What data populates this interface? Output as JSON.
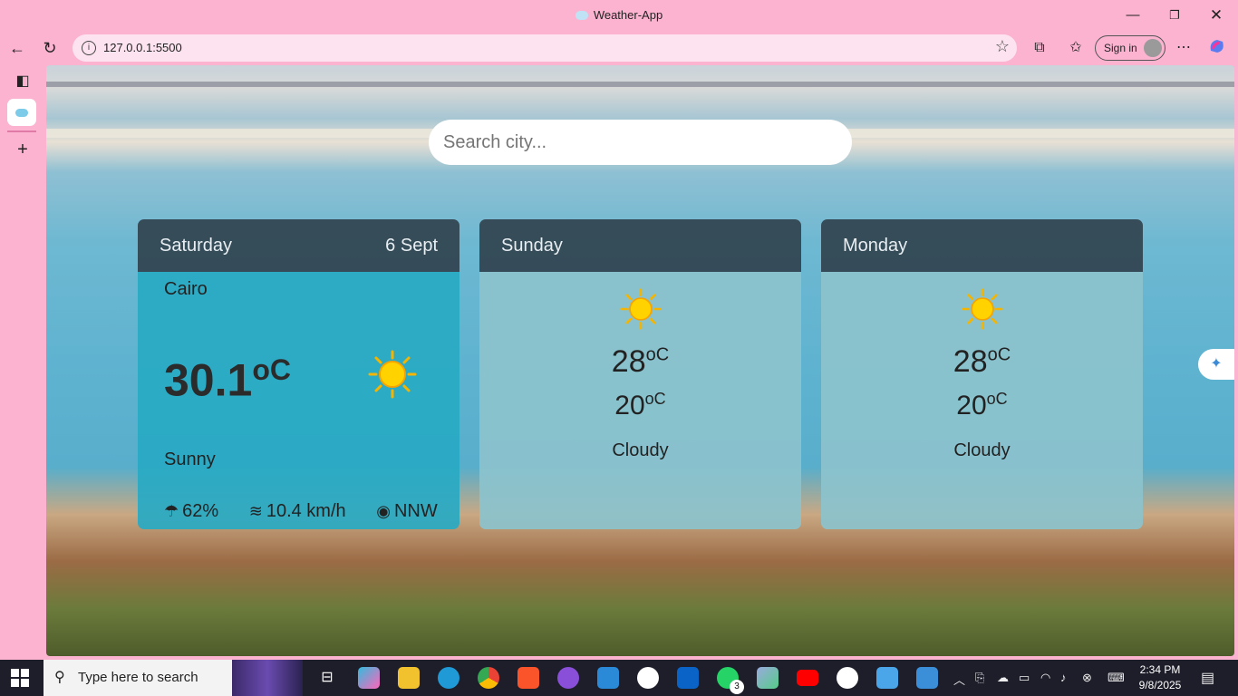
{
  "window": {
    "title": "Weather-App"
  },
  "browser": {
    "url": "127.0.0.1:5500",
    "signin_label": "Sign in"
  },
  "app": {
    "search_placeholder": "Search city...",
    "today": {
      "day": "Saturday",
      "date": "6 Sept",
      "city": "Cairo",
      "temp": "30.1",
      "unit": "oC",
      "condition": "Sunny",
      "humidity": "62%",
      "wind_speed": "10.4 km/h",
      "wind_dir": "NNW"
    },
    "forecast": [
      {
        "day": "Sunday",
        "max": "28",
        "min": "20",
        "unit": "oC",
        "condition": "Cloudy"
      },
      {
        "day": "Monday",
        "max": "28",
        "min": "20",
        "unit": "oC",
        "condition": "Cloudy"
      }
    ]
  },
  "taskbar": {
    "search_placeholder": "Type here to search",
    "time": "2:34 PM",
    "date": "9/8/2025",
    "whatsapp_badge": "3"
  },
  "colors": {
    "browser_chrome": "#fbb3d0",
    "card_header": "#2d3c48",
    "today_body": "#29aac4",
    "forecast_body": "#8cc3cc"
  }
}
